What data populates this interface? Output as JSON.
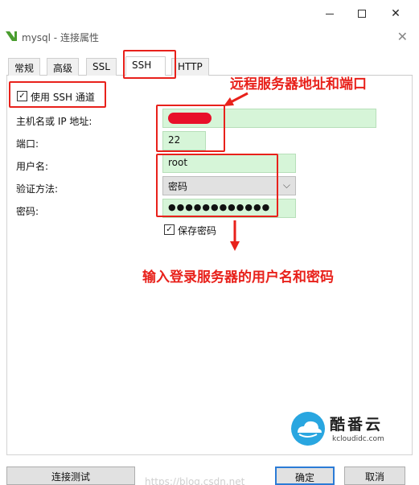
{
  "window": {
    "min": "—",
    "max": "☐",
    "close": "✕"
  },
  "dialog": {
    "title": "mysql - 连接属性",
    "close": "✕"
  },
  "tabs": [
    {
      "label": "常规"
    },
    {
      "label": "高级"
    },
    {
      "label": "SSL"
    },
    {
      "label": "SSH",
      "active": true
    },
    {
      "label": "HTTP"
    }
  ],
  "ssh": {
    "use_tunnel_label": "使用 SSH 通道",
    "use_tunnel_checked": true,
    "host_label": "主机名或 IP 地址:",
    "host_value": "",
    "port_label": "端口:",
    "port_value": "22",
    "user_label": "用户名:",
    "user_value": "root",
    "auth_label": "验证方法:",
    "auth_value": "密码",
    "password_label": "密码:",
    "password_value": "●●●●●●●●●●●●",
    "save_password_label": "保存密码",
    "save_password_checked": true
  },
  "annotations": {
    "server": "远程服务器地址和端口",
    "login": "输入登录服务器的用户名和密码"
  },
  "brand": {
    "name": "酷番云",
    "domain": "kcloudidc.com"
  },
  "buttons": {
    "test": "连接测试",
    "ok": "确定",
    "cancel": "取消"
  },
  "watermark": "https://blog.csdn.net",
  "colors": {
    "accent": "#e8211b",
    "field_bg": "#d6f5d8",
    "primary_border": "#2b7bd6"
  }
}
